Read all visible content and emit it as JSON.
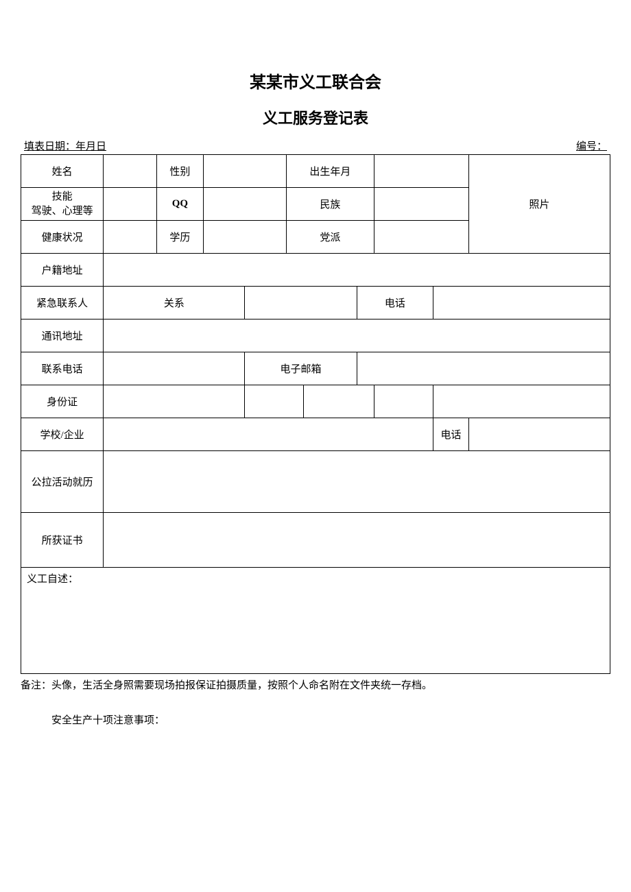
{
  "title": "某某市义工联合会",
  "subtitle": "义工服务登记表",
  "header": {
    "fillDate": "填表日期：年月日",
    "number": "编号："
  },
  "labels": {
    "name": "姓名",
    "gender": "性别",
    "birthDate": "出生年月",
    "skillLine1": "技能",
    "skillLine2": "驾驶、心理等",
    "qq": "QQ",
    "ethnicity": "民族",
    "photo": "照片",
    "health": "健康状况",
    "education": "学历",
    "party": "党派",
    "registeredAddress": "户籍地址",
    "emergencyContact": "紧急联系人",
    "relation": "关系",
    "phone": "电话",
    "mailingAddress": "通讯地址",
    "contactPhone": "联系电话",
    "email": "电子邮箱",
    "idCard": "身份证",
    "schoolCompany": "学校/企业",
    "activityHistory": "公拉活动就历",
    "certificates": "所获证书",
    "selfStatement": "义工自述："
  },
  "values": {
    "name": "",
    "gender": "",
    "birthDate": "",
    "skill": "",
    "qq": "",
    "ethnicity": "",
    "health": "",
    "education": "",
    "party": "",
    "registeredAddress": "",
    "emergencyContact": "",
    "relation": "",
    "emergencyPhone": "",
    "mailingAddress": "",
    "contactPhone": "",
    "email": "",
    "idCard1": "",
    "idCard2": "",
    "idCard3": "",
    "idCard4": "",
    "schoolCompany": "",
    "schoolPhone": "",
    "activityHistory": "",
    "certificates": "",
    "selfStatement": ""
  },
  "note": "备注：头像，生活全身照需要现场拍报保证拍摄质量，按照个人命名附在文件夹统一存档。",
  "safetyNote": "安全生产十项注意事项："
}
